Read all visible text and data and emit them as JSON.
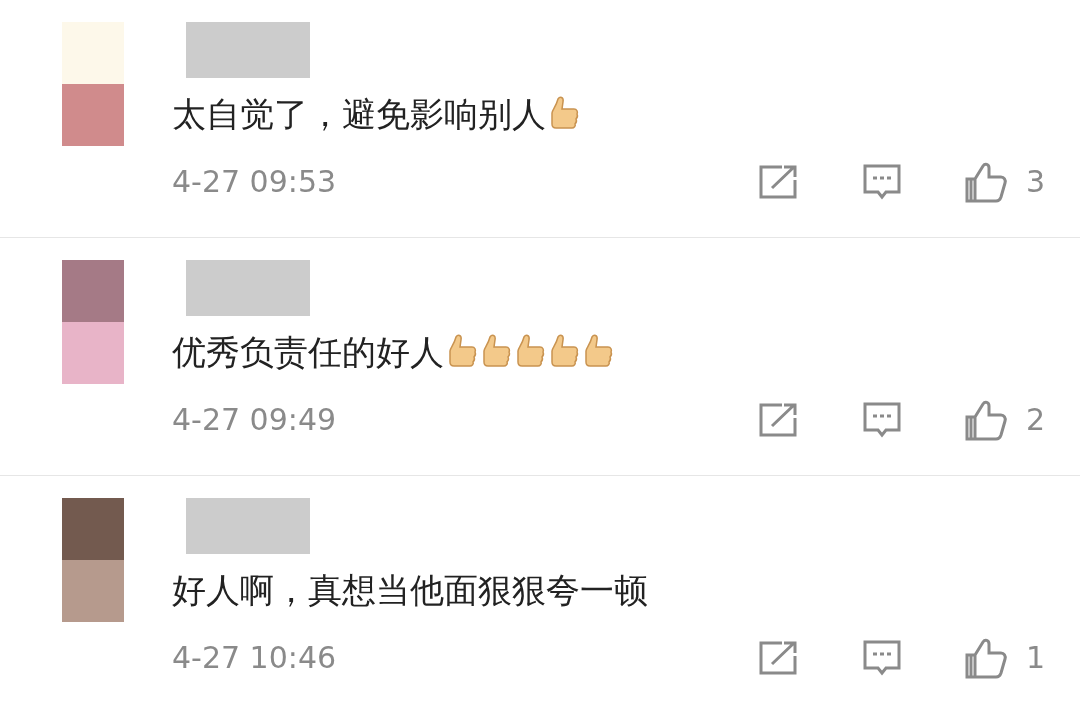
{
  "comments": [
    {
      "text": "太自觉了，避免影响别人",
      "emojis": [
        {
          "kind": "thumbs-up"
        }
      ],
      "time": "4-27 09:53",
      "likes": "3"
    },
    {
      "text": "优秀负责任的好人",
      "emojis": [
        {
          "kind": "thumbs-up"
        },
        {
          "kind": "thumbs-up"
        },
        {
          "kind": "thumbs-up"
        },
        {
          "kind": "thumbs-up"
        },
        {
          "kind": "thumbs-up"
        }
      ],
      "time": "4-27 09:49",
      "likes": "2"
    },
    {
      "text": "好人啊，真想当他面狠狠夸一顿",
      "time": "4-27 10:46",
      "likes": "1"
    }
  ]
}
